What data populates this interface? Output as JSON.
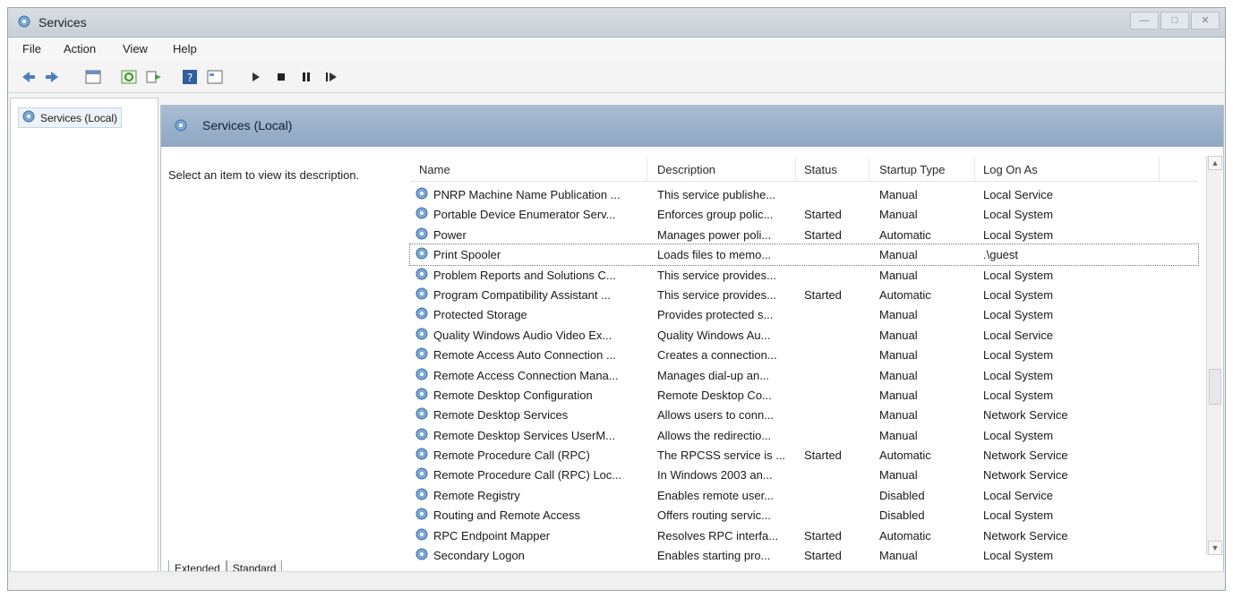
{
  "window": {
    "title": "Services",
    "controls": [
      "—",
      "□",
      "✕"
    ]
  },
  "menu": [
    "File",
    "Action",
    "View",
    "Help"
  ],
  "toolbar": {
    "icons": [
      "back-icon",
      "forward-icon",
      "console-tree-icon",
      "refresh-icon",
      "export-icon",
      "help-icon",
      "properties-icon",
      "play-icon",
      "stop-icon",
      "pause-icon",
      "restart-icon"
    ]
  },
  "tree": {
    "root_label": "Services (Local)"
  },
  "main": {
    "header_title": "Services (Local)",
    "description_prompt": "Select an item to view its description.",
    "columns": [
      "Name",
      "Description",
      "Status",
      "Startup Type",
      "Log On As"
    ],
    "rows": [
      {
        "name": "PNRP Machine Name Publication ...",
        "desc": "This service publishe...",
        "status": "",
        "startup": "Manual",
        "logon": "Local Service"
      },
      {
        "name": "Portable Device Enumerator Serv...",
        "desc": "Enforces group polic...",
        "status": "Started",
        "startup": "Manual",
        "logon": "Local System"
      },
      {
        "name": "Power",
        "desc": "Manages power poli...",
        "status": "Started",
        "startup": "Automatic",
        "logon": "Local System"
      },
      {
        "name": "Print Spooler",
        "desc": "Loads files to memo...",
        "status": "",
        "startup": "Manual",
        "logon": ".\\guest"
      },
      {
        "name": "Problem Reports and Solutions C...",
        "desc": "This service provides...",
        "status": "",
        "startup": "Manual",
        "logon": "Local System"
      },
      {
        "name": "Program Compatibility Assistant ...",
        "desc": "This service provides...",
        "status": "Started",
        "startup": "Automatic",
        "logon": "Local System"
      },
      {
        "name": "Protected Storage",
        "desc": "Provides protected s...",
        "status": "",
        "startup": "Manual",
        "logon": "Local System"
      },
      {
        "name": "Quality Windows Audio Video Ex...",
        "desc": "Quality Windows Au...",
        "status": "",
        "startup": "Manual",
        "logon": "Local Service"
      },
      {
        "name": "Remote Access Auto Connection ...",
        "desc": "Creates a connection...",
        "status": "",
        "startup": "Manual",
        "logon": "Local System"
      },
      {
        "name": "Remote Access Connection Mana...",
        "desc": "Manages dial-up an...",
        "status": "",
        "startup": "Manual",
        "logon": "Local System"
      },
      {
        "name": "Remote Desktop Configuration",
        "desc": "Remote Desktop Co...",
        "status": "",
        "startup": "Manual",
        "logon": "Local System"
      },
      {
        "name": "Remote Desktop Services",
        "desc": "Allows users to conn...",
        "status": "",
        "startup": "Manual",
        "logon": "Network Service"
      },
      {
        "name": "Remote Desktop Services UserM...",
        "desc": "Allows the redirectio...",
        "status": "",
        "startup": "Manual",
        "logon": "Local System"
      },
      {
        "name": "Remote Procedure Call (RPC)",
        "desc": "The RPCSS service is ...",
        "status": "Started",
        "startup": "Automatic",
        "logon": "Network Service"
      },
      {
        "name": "Remote Procedure Call (RPC) Loc...",
        "desc": "In Windows 2003 an...",
        "status": "",
        "startup": "Manual",
        "logon": "Network Service"
      },
      {
        "name": "Remote Registry",
        "desc": "Enables remote user...",
        "status": "",
        "startup": "Disabled",
        "logon": "Local Service"
      },
      {
        "name": "Routing and Remote Access",
        "desc": "Offers routing servic...",
        "status": "",
        "startup": "Disabled",
        "logon": "Local System"
      },
      {
        "name": "RPC Endpoint Mapper",
        "desc": "Resolves RPC interfa...",
        "status": "Started",
        "startup": "Automatic",
        "logon": "Network Service"
      },
      {
        "name": "Secondary Logon",
        "desc": "Enables starting pro...",
        "status": "Started",
        "startup": "Manual",
        "logon": "Local System"
      }
    ],
    "selected_row_index": 3
  },
  "tabs": [
    "Extended",
    "Standard"
  ],
  "colors": {
    "header_bg": "#9fb5cf",
    "selected_outline": "#777777"
  }
}
